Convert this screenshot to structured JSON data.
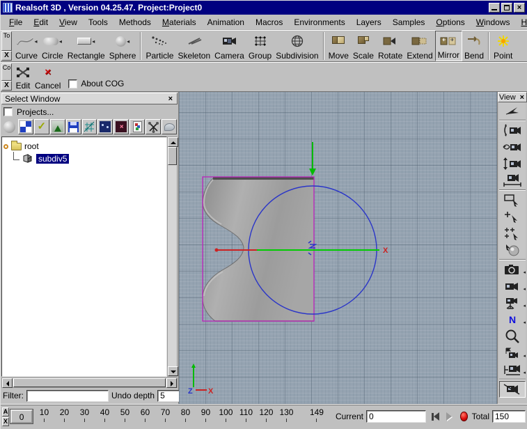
{
  "window": {
    "title": "Realsoft 3D , Version 04.25.47. Project:Project0",
    "controls": [
      "minimize",
      "maximize",
      "close"
    ],
    "title_bar_color": "#000080"
  },
  "menu": {
    "items": [
      {
        "label": "File",
        "accel": true
      },
      {
        "label": "Edit",
        "accel": true
      },
      {
        "label": "View",
        "accel": true
      },
      {
        "label": "Tools",
        "accel": false
      },
      {
        "label": "Methods",
        "accel": false
      },
      {
        "label": "Materials",
        "accel": true
      },
      {
        "label": "Animation",
        "accel": false
      },
      {
        "label": "Macros",
        "accel": false
      },
      {
        "label": "Environments",
        "accel": false
      },
      {
        "label": "Layers",
        "accel": false
      },
      {
        "label": "Samples",
        "accel": false
      },
      {
        "label": "Options",
        "accel": true
      },
      {
        "label": "Windows",
        "accel": true
      },
      {
        "label": "Help",
        "accel": true
      }
    ]
  },
  "toolbar_main": {
    "tab": "To",
    "tab_close": "X",
    "dropdown_glyph": "◂",
    "buttons": [
      {
        "label": "Curve",
        "icon": "curve-icon",
        "dropdown": true
      },
      {
        "label": "Circle",
        "icon": "circle-icon",
        "dropdown": true
      },
      {
        "label": "Rectangle",
        "icon": "rectangle-icon",
        "dropdown": true
      },
      {
        "label": "Sphere",
        "icon": "sphere-icon",
        "dropdown": true
      },
      {
        "label": "Particle",
        "icon": "particle-icon",
        "dropdown": false
      },
      {
        "label": "Skeleton",
        "icon": "skeleton-icon",
        "dropdown": false
      },
      {
        "label": "Camera",
        "icon": "camera-icon",
        "dropdown": false
      },
      {
        "label": "Group",
        "icon": "group-icon",
        "dropdown": false
      },
      {
        "label": "Subdivision",
        "icon": "subdivision-icon",
        "dropdown": false
      },
      {
        "label": "Move",
        "icon": "move-icon",
        "dropdown": false
      },
      {
        "label": "Scale",
        "icon": "scale-icon",
        "dropdown": false
      },
      {
        "label": "Rotate",
        "icon": "rotate-icon",
        "dropdown": false
      },
      {
        "label": "Extend",
        "icon": "extend-icon",
        "dropdown": false
      },
      {
        "label": "Mirror",
        "icon": "mirror-icon",
        "dropdown": false,
        "pressed": true
      },
      {
        "label": "Bend",
        "icon": "bend-icon",
        "dropdown": false
      },
      {
        "label": "Point",
        "icon": "point-icon",
        "dropdown": false
      }
    ]
  },
  "toolbar_edit": {
    "tab": "Co",
    "tab_close": "X",
    "edit_label": "Edit",
    "cancel_label": "Cancel",
    "cancel_glyph": "×",
    "about_cog_label": "About COG",
    "about_cog_checked": false
  },
  "select_window": {
    "title": "Select Window",
    "close_glyph": "×",
    "projects_label": "Projects...",
    "projects_checked": false,
    "icons": [
      "sphere-icon",
      "checker-material-icon",
      "check-accept-icon",
      "environment-tree-icon",
      "save-floppy-icon",
      "grid-transform-icon",
      "night-scene-icon",
      "star-light-icon",
      "paste-clipboard-icon",
      "skeleton-node-icon",
      "lasso-icon"
    ],
    "tree": {
      "root_label": "root",
      "child_label": "subdiv5",
      "child_selected": true
    },
    "filter_label": "Filter:",
    "filter_value": "",
    "undo_label": "Undo depth",
    "undo_value": "5"
  },
  "viewport": {
    "background_color": "#95a3b1",
    "rect_color": "#bb22bb",
    "circle_color": "#2a35c8",
    "axis_green": "#00bb00",
    "axis_red": "#cc2222",
    "center_label": "z",
    "handle_x_label": "X",
    "origin_z_label": "Z",
    "origin_x_label": "X"
  },
  "view_panel": {
    "title": "View",
    "close_glyph": "×",
    "n_label": "N",
    "dropdown_glyph": "◂",
    "icons": [
      "view-direction-icon",
      "camera-tilt-icon",
      "camera-orbit-icon",
      "camera-raise-icon",
      "camera-track-icon",
      "zoom-box-cursor-icon",
      "add-point-cursor-icon",
      "multi-point-cursor-icon",
      "sphere-drag-icon",
      "photo-camera-icon",
      "video-camera-icon",
      "camera-tripod-icon",
      "normal-n-icon",
      "zoom-magnifier-icon",
      "camera-flag-icon",
      "camera-rail-icon",
      "camera-disabled-icon"
    ]
  },
  "timeline": {
    "tab_a": "A",
    "tab_close": "X",
    "handle_value": "0",
    "ticks": [
      "10",
      "20",
      "30",
      "40",
      "50",
      "60",
      "70",
      "80",
      "90",
      "100",
      "110",
      "120",
      "130",
      "149"
    ],
    "current_label": "Current",
    "current_value": "0",
    "total_label": "Total",
    "total_value": "150",
    "record_color": "#dd1111"
  }
}
